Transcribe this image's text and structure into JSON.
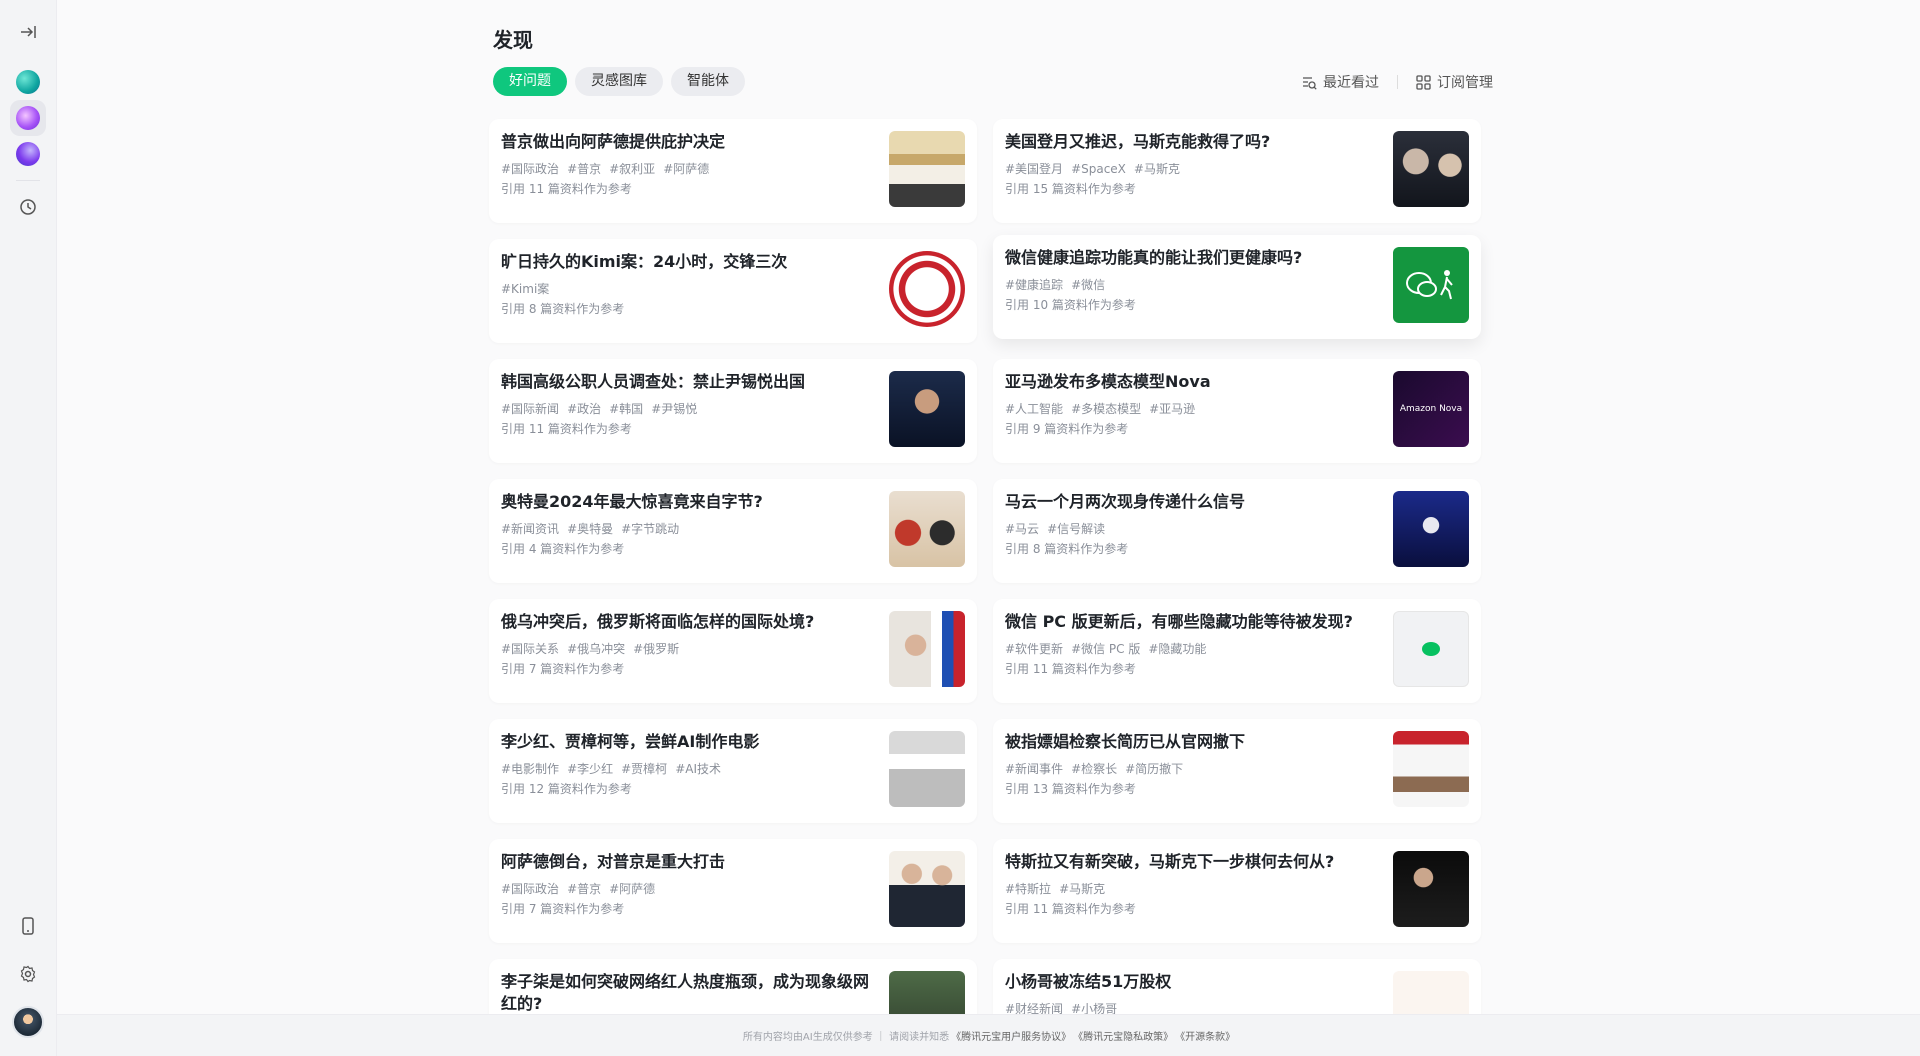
{
  "page": {
    "title": "发现"
  },
  "tabs": [
    {
      "label": "好问题",
      "active": true
    },
    {
      "label": "灵感图库",
      "active": false
    },
    {
      "label": "智能体",
      "active": false
    }
  ],
  "toolbar": {
    "recent_label": "最近看过",
    "subscribe_label": "订阅管理"
  },
  "colors": {
    "accent": "#0fc77e"
  },
  "cards_left": [
    {
      "title": "普京做出向阿萨德提供庇护决定",
      "tags": [
        "#国际政治",
        "#普京",
        "#叙利亚",
        "#阿萨德"
      ],
      "ref": "引用 11 篇资料作为参考"
    },
    {
      "title": "旷日持久的Kimi案：24小时，交锋三次",
      "tags": [
        "#Kimi案"
      ],
      "ref": "引用 8 篇资料作为参考"
    },
    {
      "title": "韩国高级公职人员调查处：禁止尹锡悦出国",
      "tags": [
        "#国际新闻",
        "#政治",
        "#韩国",
        "#尹锡悦"
      ],
      "ref": "引用 11 篇资料作为参考"
    },
    {
      "title": "奥特曼2024年最大惊喜竟来自字节?",
      "tags": [
        "#新闻资讯",
        "#奥特曼",
        "#字节跳动"
      ],
      "ref": "引用 4 篇资料作为参考"
    },
    {
      "title": "俄乌冲突后，俄罗斯将面临怎样的国际处境?",
      "tags": [
        "#国际关系",
        "#俄乌冲突",
        "#俄罗斯"
      ],
      "ref": "引用 7 篇资料作为参考"
    },
    {
      "title": "李少红、贾樟柯等，尝鲜AI制作电影",
      "tags": [
        "#电影制作",
        "#李少红",
        "#贾樟柯",
        "#AI技术"
      ],
      "ref": "引用 12 篇资料作为参考"
    },
    {
      "title": "阿萨德倒台，对普京是重大打击",
      "tags": [
        "#国际政治",
        "#普京",
        "#阿萨德"
      ],
      "ref": "引用 7 篇资料作为参考"
    },
    {
      "title": "李子柒是如何突破网络红人热度瓶颈，成为现象级网红的?",
      "tags": [],
      "ref": ""
    }
  ],
  "cards_right": [
    {
      "title": "美国登月又推迟，马斯克能救得了吗?",
      "tags": [
        "#美国登月",
        "#SpaceX",
        "#马斯克"
      ],
      "ref": "引用 15 篇资料作为参考"
    },
    {
      "title": "微信健康追踪功能真的能让我们更健康吗?",
      "tags": [
        "#健康追踪",
        "#微信"
      ],
      "ref": "引用 10 篇资料作为参考"
    },
    {
      "title": "亚马逊发布多模态模型Nova",
      "tags": [
        "#人工智能",
        "#多模态模型",
        "#亚马逊"
      ],
      "ref": "引用 9 篇资料作为参考"
    },
    {
      "title": "马云一个月两次现身传递什么信号",
      "tags": [
        "#马云",
        "#信号解读"
      ],
      "ref": "引用 8 篇资料作为参考"
    },
    {
      "title": "微信 PC 版更新后，有哪些隐藏功能等待被发现?",
      "tags": [
        "#软件更新",
        "#微信 PC 版",
        "#隐藏功能"
      ],
      "ref": "引用 11 篇资料作为参考"
    },
    {
      "title": "被指嫖娼检察长简历已从官网撤下",
      "tags": [
        "#新闻事件",
        "#检察长",
        "#简历撤下"
      ],
      "ref": "引用 13 篇资料作为参考"
    },
    {
      "title": "特斯拉又有新突破，马斯克下一步棋何去何从?",
      "tags": [
        "#特斯拉",
        "#马斯克"
      ],
      "ref": "引用 11 篇资料作为参考"
    },
    {
      "title": "小杨哥被冻结51万股权",
      "tags": [
        "#财经新闻",
        "#小杨哥"
      ],
      "ref": ""
    }
  ],
  "footer": {
    "prefix": "所有内容均由AI生成仅供参考 ｜ 请阅读并知悉",
    "link1": "《腾讯元宝用户服务协议》",
    "link2": "《腾讯元宝隐私政策》",
    "link3": "《开源条款》"
  }
}
